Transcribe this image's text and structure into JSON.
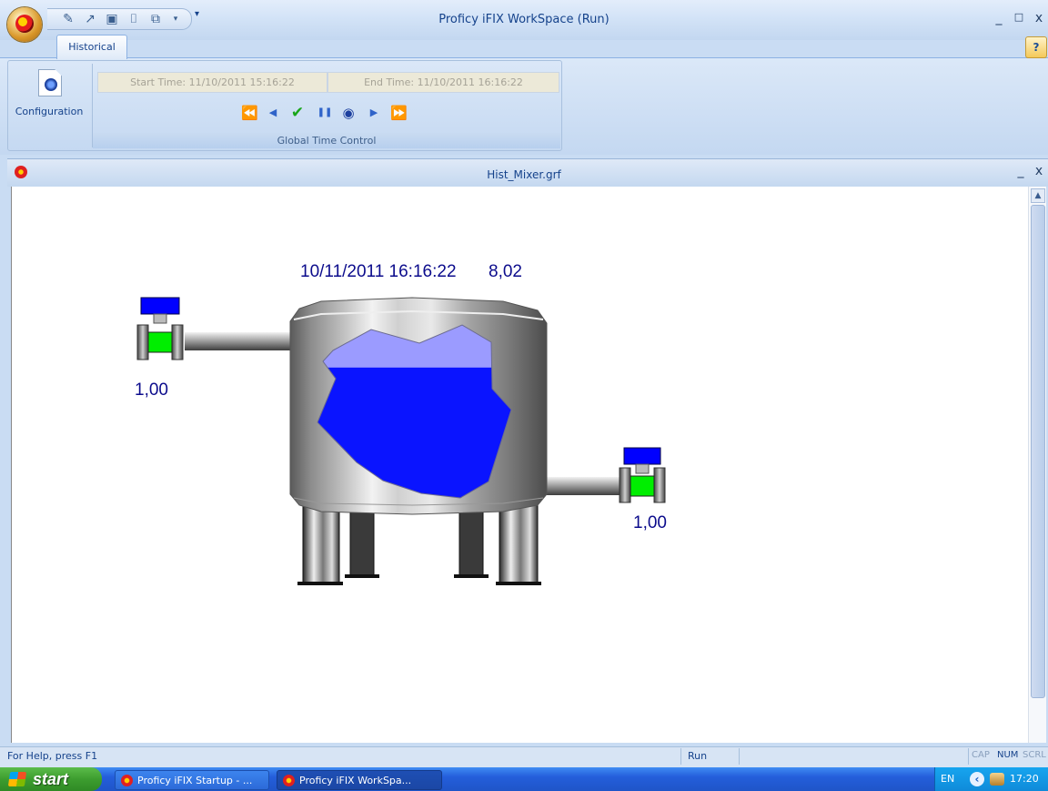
{
  "window": {
    "title": "Proficy iFIX WorkSpace (Run)",
    "minimize": "_",
    "restore": "□",
    "close": "x"
  },
  "ribbon": {
    "tab_historical": "Historical",
    "help": "?",
    "config_label": "Configuration",
    "start_time": "Start Time: 11/10/2011 15:16:22",
    "end_time": "End Time: 11/10/2011 16:16:22",
    "group_caption": "Global Time Control",
    "nav": {
      "rewind": "⏪",
      "step_back": "◀",
      "apply": "✔",
      "pause": "❚❚",
      "clock": "◉",
      "step_forward": "▶",
      "fast_forward": "⏩"
    }
  },
  "document": {
    "title": "Hist_Mixer.grf",
    "minimize": "_",
    "close": "x"
  },
  "hmi": {
    "timestamp": "10/11/2011 16:16:22",
    "level_value": "8,02",
    "inlet_valve_value": "1,00",
    "outlet_valve_value": "1,00",
    "level_fraction": 0.75,
    "colors": {
      "liquid": "#0a14ff",
      "liquid_top": "#9b9bff",
      "valve_body": "#00ee00",
      "valve_actuator": "#0000ff",
      "text": "#0c0c8c"
    }
  },
  "status": {
    "help": "For Help, press F1",
    "mode": "Run",
    "cap": "CAP",
    "num": "NUM",
    "scrl": "SCRL"
  },
  "taskbar": {
    "start": "start",
    "task1": "Proficy iFIX Startup - ...",
    "task2": "Proficy iFIX WorkSpa...",
    "lang": "EN",
    "clock": "17:20"
  }
}
